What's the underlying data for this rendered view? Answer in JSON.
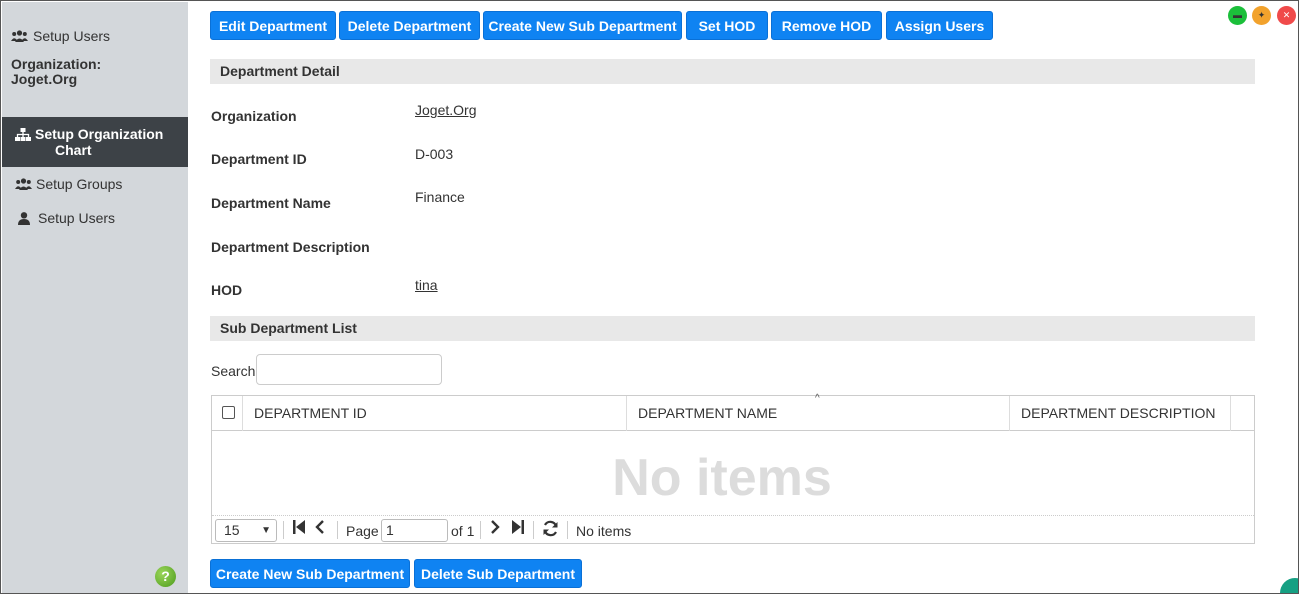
{
  "sidebar": {
    "header_label": "Setup Users",
    "org_label": "Organization:",
    "org_name": "Joget.Org",
    "items": [
      {
        "label_line1": "Setup Organization",
        "label_line2": "Chart",
        "icon": "sitemap-icon",
        "active": true
      },
      {
        "label": "Setup Groups",
        "icon": "users-icon",
        "active": false
      },
      {
        "label": "Setup Users",
        "icon": "user-icon",
        "active": false
      }
    ],
    "help_glyph": "?"
  },
  "toolbar": {
    "edit_department": "Edit Department",
    "delete_department": "Delete Department",
    "create_sub_department": "Create New Sub Department",
    "set_hod": "Set HOD",
    "remove_hod": "Remove HOD",
    "assign_users": "Assign Users"
  },
  "detail": {
    "section_title": "Department Detail",
    "fields": [
      {
        "label": "Organization",
        "value": "Joget.Org",
        "link": true
      },
      {
        "label": "Department ID",
        "value": "D-003",
        "link": false
      },
      {
        "label": "Department Name",
        "value": "Finance",
        "link": false
      },
      {
        "label": "Department Description",
        "value": "",
        "link": false
      },
      {
        "label": "HOD",
        "value": "tina",
        "link": true
      }
    ]
  },
  "sub_list": {
    "section_title": "Sub Department List",
    "search_label": "Search",
    "search_value": "",
    "columns": [
      "DEPARTMENT ID",
      "DEPARTMENT NAME",
      "DEPARTMENT DESCRIPTION"
    ],
    "empty_text": "No items",
    "pager": {
      "page_size": "15",
      "page_label": "Page",
      "page_value": "1",
      "of_label": "of 1",
      "status": "No items"
    }
  },
  "bottom_buttons": {
    "create_sub_department": "Create New Sub Department",
    "delete_sub_department": "Delete Sub Department"
  },
  "colors": {
    "primary_button": "#0f83f2",
    "sidebar_bg": "#d3d7db",
    "sidebar_active": "#3d4247",
    "section_bg": "#e8e8e8"
  }
}
